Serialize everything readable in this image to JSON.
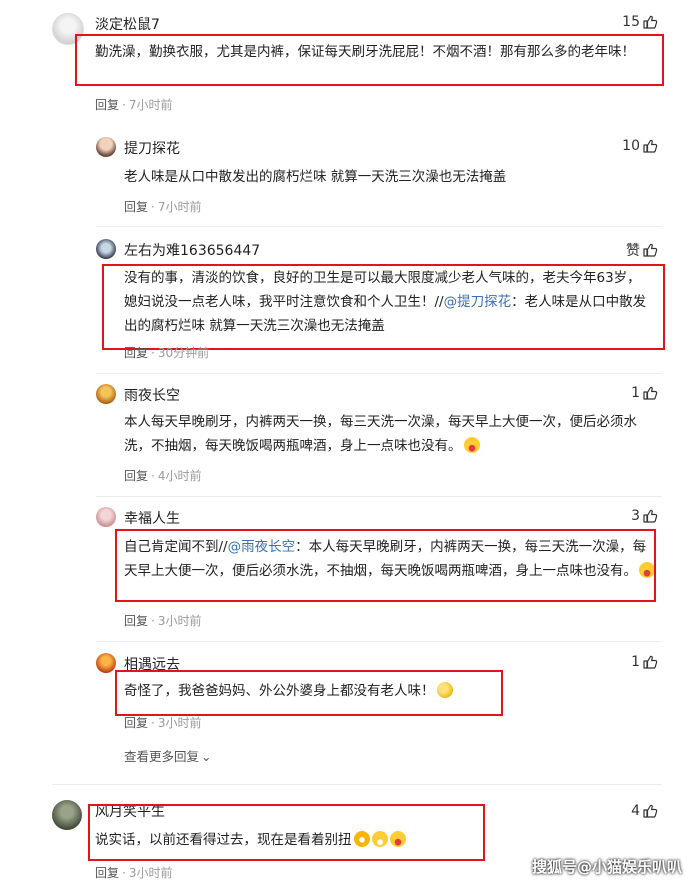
{
  "comments": [
    {
      "username": "淡定松鼠7",
      "likes": "15",
      "text": "勤洗澡，勤换衣服，尤其是内裤，保证每天刷牙洗屁屁！不烟不酒！那有那么多的老年味！",
      "reply_label": "回复",
      "time": "7小时前",
      "replies": [
        {
          "username": "提刀探花",
          "likes": "10",
          "text": "老人味是从口中散发出的腐朽烂味 就算一天洗三次澡也无法掩盖",
          "reply_label": "回复",
          "time": "7小时前"
        },
        {
          "username": "左右为难163656447",
          "likes": "赞",
          "text_prefix": "没有的事，清淡的饮食，良好的卫生是可以最大限度减少老人气味的，老夫今年63岁，媳妇说没一点老人味，我平时注意饮食和个人卫生！//",
          "mention": "@提刀探花",
          "text_suffix": "：老人味是从口中散发出的腐朽烂味 就算一天洗三次澡也无法掩盖",
          "reply_label": "回复",
          "time": "30分钟前"
        },
        {
          "username": "雨夜长空",
          "likes": "1",
          "text": "本人每天早晚刷牙，内裤两天一换，每三天洗一次澡，每天早上大便一次，便后必须水洗，不抽烟，每天晚饭喝两瓶啤酒，身上一点味也没有。",
          "reply_label": "回复",
          "time": "4小时前"
        },
        {
          "username": "幸福人生",
          "likes": "3",
          "text_prefix": "自己肯定闻不到//",
          "mention": "@雨夜长空",
          "text_suffix": "：本人每天早晚刷牙，内裤两天一换，每三天洗一次澡，每天早上大便一次，便后必须水洗，不抽烟，每天晚饭喝两瓶啤酒，身上一点味也没有。",
          "reply_label": "回复",
          "time": "3小时前"
        },
        {
          "username": "相遇远去",
          "likes": "1",
          "text": "奇怪了，我爸爸妈妈、外公外婆身上都没有老人味！",
          "reply_label": "回复",
          "time": "3小时前"
        }
      ],
      "more_replies": "查看更多回复"
    },
    {
      "username": "风月笑平生",
      "likes": "4",
      "text": "说实话，以前还看得过去，现在是看着别扭",
      "reply_label": "回复",
      "time": "3小时前"
    }
  ],
  "watermark": "搜狐号@小猫娱乐叭叭",
  "colors": {
    "highlight_box": "#e0151b",
    "mention": "#3a6fb0",
    "meta_gray": "#9a9a9a"
  }
}
